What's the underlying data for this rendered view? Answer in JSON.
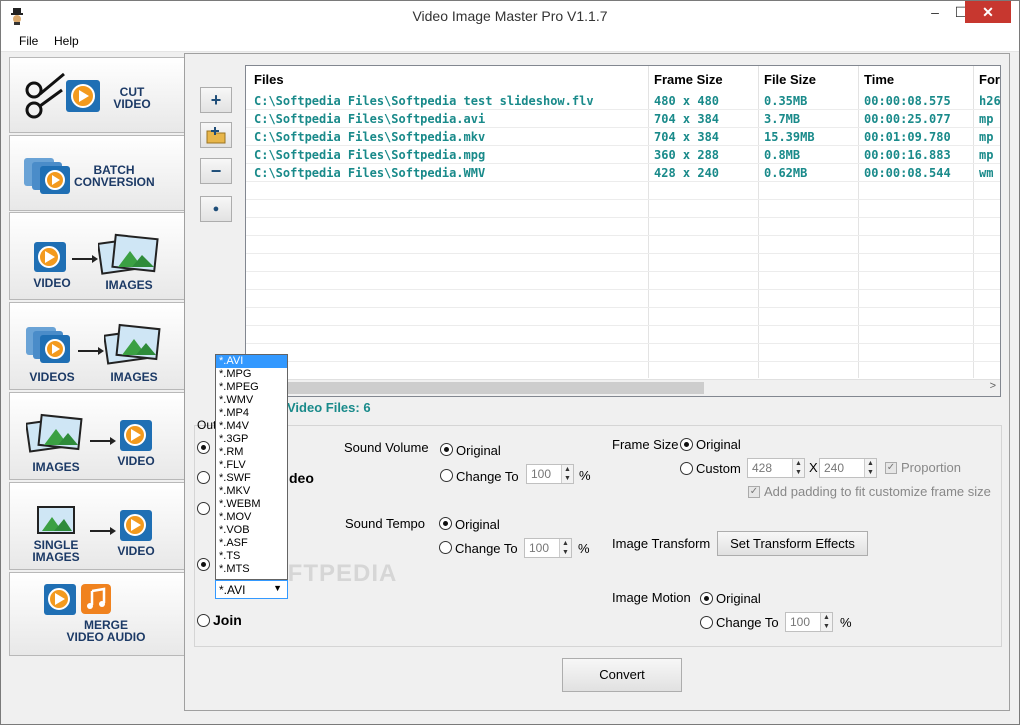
{
  "window": {
    "title": "Video Image Master Pro V1.1.7",
    "min": "–",
    "max": "☐",
    "close": "✕"
  },
  "menu": [
    "File",
    "Help"
  ],
  "sidebar": [
    {
      "l1": "CUT",
      "l2": "VIDEO"
    },
    {
      "l1": "BATCH",
      "l2": "CONVERSION"
    },
    {
      "a": "VIDEO",
      "b": "IMAGES"
    },
    {
      "a": "VIDEOS",
      "b": "IMAGES"
    },
    {
      "a": "IMAGES",
      "b": "VIDEO"
    },
    {
      "a1": "SINGLE",
      "a2": "IMAGES",
      "b": "VIDEO"
    },
    {
      "l1": "MERGE",
      "l2": "VIDEO AUDIO"
    }
  ],
  "toolbar": {
    "add": "+",
    "remove": "−",
    "dot": "●"
  },
  "table": {
    "headers": [
      "Files",
      "Frame Size",
      "File Size",
      "Time",
      "For"
    ],
    "rows": [
      [
        "C:\\Softpedia Files\\Softpedia test slideshow.flv",
        "480 x 480",
        "0.35MB",
        "00:00:08.575",
        "h26"
      ],
      [
        "C:\\Softpedia Files\\Softpedia.avi",
        "704 x 384",
        "3.7MB",
        "00:00:25.077",
        "mp"
      ],
      [
        "C:\\Softpedia Files\\Softpedia.mkv",
        "704 x 384",
        "15.39MB",
        "00:01:09.780",
        "mp"
      ],
      [
        "C:\\Softpedia Files\\Softpedia.mpg",
        "360 x 288",
        "0.8MB",
        "00:00:16.883",
        "mp"
      ],
      [
        "C:\\Softpedia Files\\Softpedia.WMV",
        "428 x 240",
        "0.62MB",
        "00:00:08.544",
        "wm"
      ]
    ]
  },
  "count": "Video Files: 6",
  "options": {
    "out": "Out",
    "deo": "deo",
    "join": "Join",
    "sound_volume": "Sound Volume",
    "sound_tempo": "Sound Tempo",
    "original": "Original",
    "change_to": "Change To",
    "percent": "%",
    "volume_value": "100",
    "tempo_value": "100",
    "frame_size": "Frame Size",
    "custom": "Custom",
    "width": "428",
    "height": "240",
    "times": "X",
    "proportion": "Proportion",
    "padding": "Add padding to fit customize frame size",
    "image_transform": "Image Transform",
    "set_transform": "Set Transform Effects",
    "image_motion": "Image Motion",
    "motion_value": "100"
  },
  "formats": [
    "*.AVI",
    "*.MPG",
    "*.MPEG",
    "*.WMV",
    "*.MP4",
    "*.M4V",
    "*.3GP",
    "*.RM",
    "*.FLV",
    "*.SWF",
    "*.MKV",
    "*.WEBM",
    "*.MOV",
    "*.VOB",
    "*.ASF",
    "*.TS",
    "*.MTS"
  ],
  "selected_format": "*.AVI",
  "convert": "Convert",
  "watermark": "SOFTPEDIA"
}
